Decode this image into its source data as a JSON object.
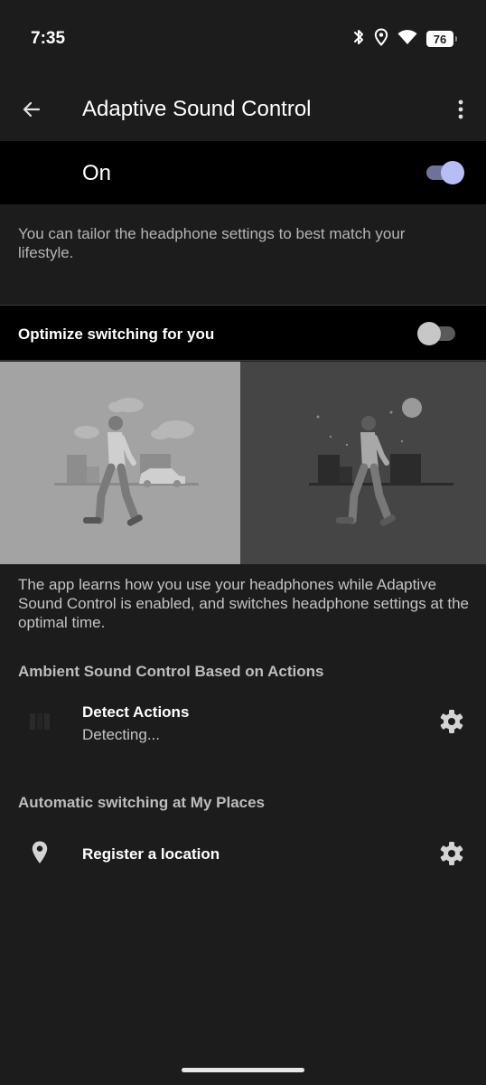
{
  "status_bar": {
    "time": "7:35",
    "battery": "76",
    "icons": [
      "bluetooth-icon",
      "location-icon",
      "wifi-icon",
      "battery-icon"
    ]
  },
  "app_bar": {
    "title": "Adaptive Sound Control",
    "back_icon": "arrow-back-icon",
    "more_icon": "more-vertical-icon"
  },
  "master_switch": {
    "label": "On",
    "state": true,
    "track_color": "#6f7199",
    "knob_color": "#b9bdf6"
  },
  "description": "You can tailor the headphone settings to best match your lifestyle.",
  "optimize_switch": {
    "label": "Optimize switching for you",
    "state": false
  },
  "info_text": "The app learns how you use your headphones while Adaptive Sound Control is enabled, and switches headphone settings at the optimal time.",
  "ambient_section": {
    "header": "Ambient Sound Control Based on Actions",
    "items": [
      {
        "title": "Detect Actions",
        "subtitle": "Detecting...",
        "icon": "activity-bars-icon",
        "action_icon": "gear-icon"
      }
    ]
  },
  "places_section": {
    "header": "Automatic switching at My Places",
    "items": [
      {
        "title": "Register a location",
        "icon": "location-pin-icon",
        "action_icon": "gear-icon"
      }
    ]
  }
}
